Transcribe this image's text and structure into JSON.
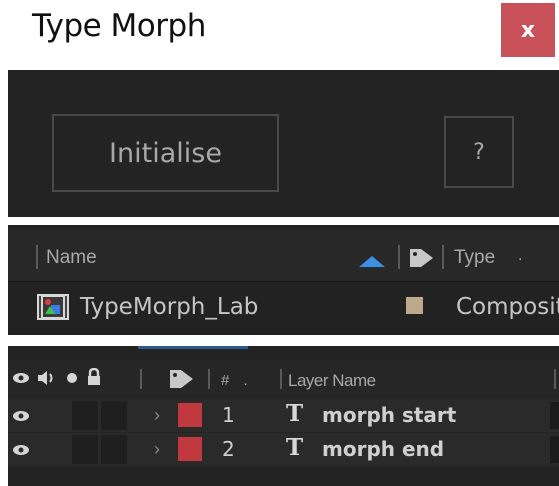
{
  "window": {
    "title": "Type Morph",
    "close_label": "x"
  },
  "panel1": {
    "initialise_label": "Initialise",
    "help_label": "?"
  },
  "project": {
    "columns": {
      "name": "Name",
      "type": "Type",
      "type_dot": "."
    },
    "items": [
      {
        "name": "TypeMorph_Lab",
        "type": "Composit",
        "label_color": "#bca98a"
      }
    ]
  },
  "timeline": {
    "columns": {
      "num": "#",
      "num_dot": ".",
      "layer_name": "Layer Name"
    },
    "layers": [
      {
        "num": "1",
        "type_glyph": "T",
        "name": "morph start",
        "label_color": "#c0393e"
      },
      {
        "num": "2",
        "type_glyph": "T",
        "name": "morph end",
        "label_color": "#c0393e"
      }
    ]
  },
  "colors": {
    "close_bg": "#c9525a",
    "sort_arrow": "#3b8fe5",
    "panel_bg": "#232323"
  }
}
